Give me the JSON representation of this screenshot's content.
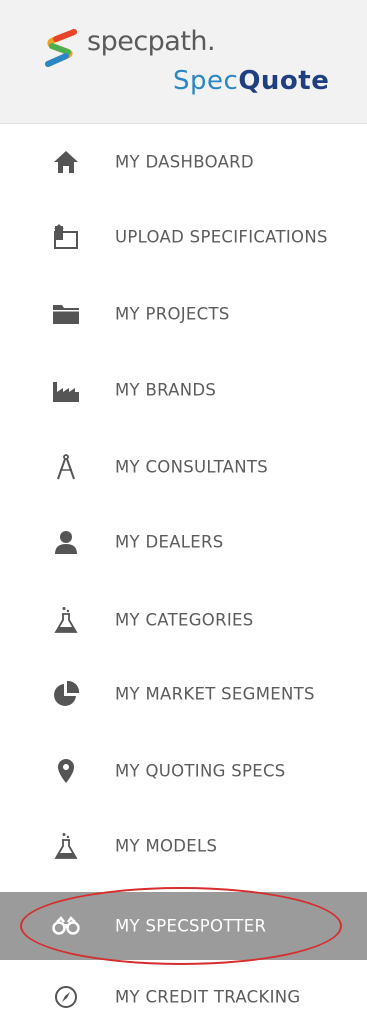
{
  "header": {
    "brand_name": "specpath.",
    "product_name_part1": "Spec",
    "product_name_part2": "Quote"
  },
  "nav": {
    "items": [
      {
        "label": "MY DASHBOARD",
        "icon": "home-icon"
      },
      {
        "label": "UPLOAD SPECIFICATIONS",
        "icon": "upload-icon"
      },
      {
        "label": "MY PROJECTS",
        "icon": "folder-icon"
      },
      {
        "label": "MY BRANDS",
        "icon": "factory-icon"
      },
      {
        "label": "MY CONSULTANTS",
        "icon": "compass-drawing-icon"
      },
      {
        "label": "MY DEALERS",
        "icon": "person-icon"
      },
      {
        "label": "MY CATEGORIES",
        "icon": "flask-icon"
      },
      {
        "label": "MY MARKET SEGMENTS",
        "icon": "pie-chart-icon"
      },
      {
        "label": "MY QUOTING SPECS",
        "icon": "map-pin-icon"
      },
      {
        "label": "MY MODELS",
        "icon": "flask-icon"
      },
      {
        "label": "MY SPECSPOTTER",
        "icon": "binoculars-icon",
        "active": true
      },
      {
        "label": "MY CREDIT TRACKING",
        "icon": "compass-icon"
      }
    ]
  },
  "colors": {
    "header_bg": "#f2f2f2",
    "active_bg": "#9b9b9b",
    "text": "#5c5c5c",
    "brand_blue": "#2a86c4",
    "brand_navy": "#1f3f80",
    "annotation_red": "#d62e2e"
  }
}
